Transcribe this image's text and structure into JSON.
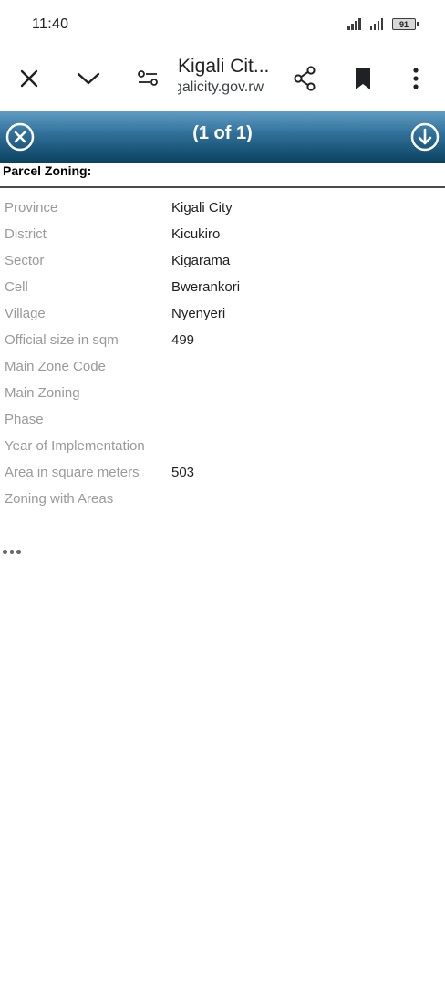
{
  "status_bar": {
    "time": "11:40",
    "battery": "91"
  },
  "toolbar": {
    "title": "Kigali Cit...",
    "domain": "galicity.gov.rw",
    "icons": [
      "close-icon",
      "chevron-down-icon",
      "page-controls-icon",
      "share-icon",
      "bookmark-icon",
      "more-vert-icon"
    ]
  },
  "popup": {
    "count": "(1 of 1)",
    "section_title": "Parcel Zoning:",
    "rows": [
      {
        "label": "Province",
        "value": "Kigali City"
      },
      {
        "label": "District",
        "value": "Kicukiro"
      },
      {
        "label": "Sector",
        "value": "Kigarama"
      },
      {
        "label": "Cell",
        "value": "Bwerankori"
      },
      {
        "label": "Village",
        "value": "Nyenyeri"
      },
      {
        "label": "Official size in sqm",
        "value": "499"
      },
      {
        "label": "Main Zone Code",
        "value": ""
      },
      {
        "label": "Main Zoning",
        "value": ""
      },
      {
        "label": "Phase",
        "value": ""
      },
      {
        "label": "Year of Implementation",
        "value": ""
      },
      {
        "label": "Area in square meters",
        "value": "503"
      },
      {
        "label": "Zoning with Areas",
        "value": ""
      }
    ]
  },
  "colors": {
    "header_top": "#5f9cc4",
    "header_bottom": "#0b4261",
    "label": "#9a9a9a",
    "value": "#1f1f1f"
  }
}
